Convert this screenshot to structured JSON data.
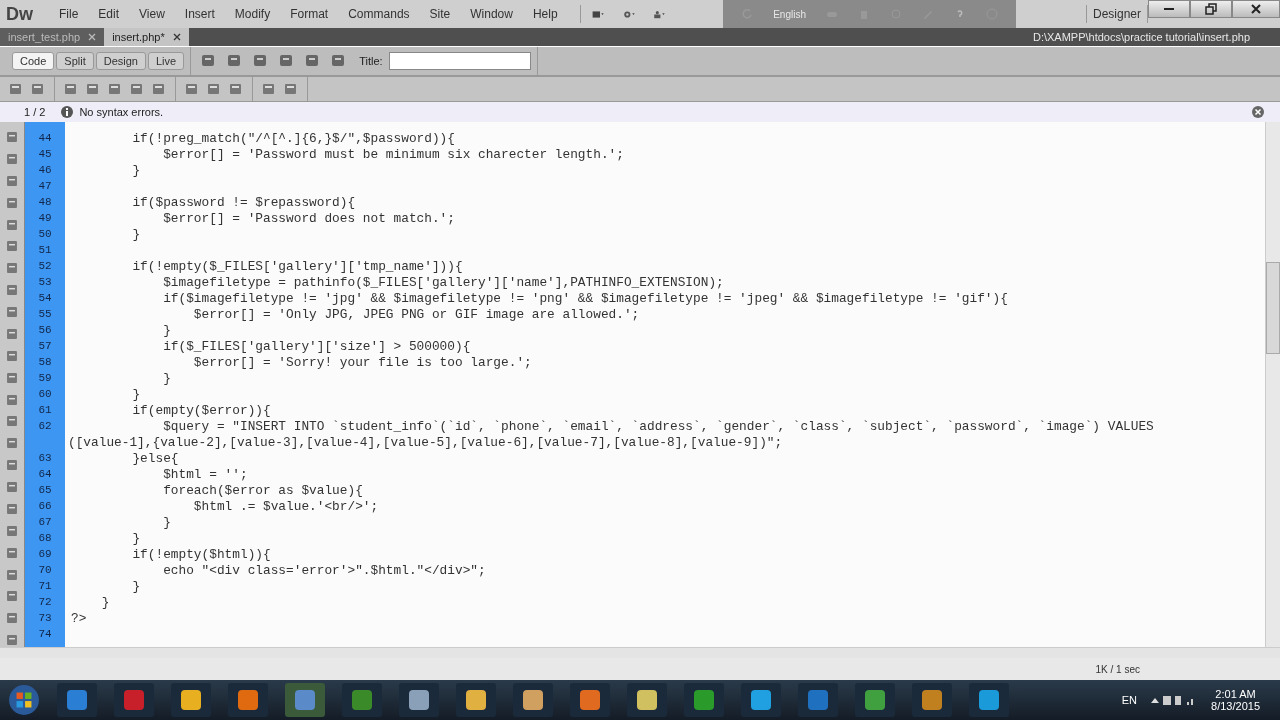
{
  "app": {
    "logo": "Dw"
  },
  "menu": [
    "File",
    "Edit",
    "View",
    "Insert",
    "Modify",
    "Format",
    "Commands",
    "Site",
    "Window",
    "Help"
  ],
  "language": "English",
  "workspace": "Designer",
  "tabs": [
    {
      "label": "insert_test.php",
      "selected": false
    },
    {
      "label": "insert.php*",
      "selected": true
    }
  ],
  "file_path": "D:\\XAMPP\\htdocs\\practice tutorial\\insert.php",
  "view_buttons": [
    {
      "label": "Code",
      "selected": true
    },
    {
      "label": "Split",
      "selected": false
    },
    {
      "label": "Design",
      "selected": false
    },
    {
      "label": "Live",
      "selected": false
    }
  ],
  "title_field": {
    "label": "Title:"
  },
  "info_bar": {
    "page": "1 / 2",
    "message": "No syntax errors."
  },
  "code_lines": [
    {
      "number": "44",
      "text": "        if(!preg_match(\"/^[^.]{6,}$/\",$password)){"
    },
    {
      "number": "45",
      "text": "            $error[] = 'Password must be minimum six charecter length.';"
    },
    {
      "number": "46",
      "text": "        }"
    },
    {
      "number": "47"
    },
    {
      "number": "48",
      "text": "        if($password != $repassword){"
    },
    {
      "number": "49",
      "text": "            $error[] = 'Password does not match.';"
    },
    {
      "number": "50",
      "text": "        }"
    },
    {
      "number": "51"
    },
    {
      "number": "52",
      "text": "        if(!empty($_FILES['gallery']['tmp_name'])){"
    },
    {
      "number": "53",
      "text": "            $imagefiletype = pathinfo($_FILES['gallery']['name'],PATHINFO_EXTENSION);"
    },
    {
      "number": "54",
      "text": "            if($imagefiletype != 'jpg' && $imagefiletype != 'png' && $imagefiletype != 'jpeg' && $imagefiletype != 'gif'){"
    },
    {
      "number": "55",
      "text": "                $error[] = 'Only JPG, JPEG PNG or GIF image are allowed.';"
    },
    {
      "number": "56",
      "text": "            }"
    },
    {
      "number": "57",
      "text": "            if($_FILES['gallery']['size'] > 500000){"
    },
    {
      "number": "58",
      "text": "                $error[] = 'Sorry! your file is too large.';"
    },
    {
      "number": "59",
      "text": "            }"
    },
    {
      "number": "60",
      "text": "        }"
    },
    {
      "number": "61",
      "text": "        if(empty($error)){"
    },
    {
      "number": "62",
      "text": "            $query = \"INSERT INTO `student_info`(`id`, `phone`, `email`, `address`, `gender`, `class`, `subject`, `password`, `image`) VALUES",
      "continuation": "([value-1],{value-2],[value-3],[value-4],[value-5],[value-6],[value-7],[value-8],[value-9])\";"
    },
    {
      "number": "63",
      "text": "        }else{"
    },
    {
      "number": "64",
      "text": "            $html = '';"
    },
    {
      "number": "65",
      "text": "            foreach($error as $value){"
    },
    {
      "number": "66",
      "text": "                $html .= $value.'<br/>';"
    },
    {
      "number": "67",
      "text": "            }"
    },
    {
      "number": "68",
      "text": "        }"
    },
    {
      "number": "69",
      "text": "        if(!empty($html)){"
    },
    {
      "number": "70",
      "text": "            echo \"<div class='error'>\".$html.\"</div>\";"
    },
    {
      "number": "71",
      "text": "        }"
    },
    {
      "number": "72",
      "text": "    }"
    },
    {
      "number": "73",
      "text": "?>"
    },
    {
      "number": "74"
    }
  ],
  "status_bar": {
    "size": "1K / 1 sec"
  },
  "taskbar": {
    "language": "EN",
    "time": "2:01 AM",
    "date": "8/13/2015"
  }
}
